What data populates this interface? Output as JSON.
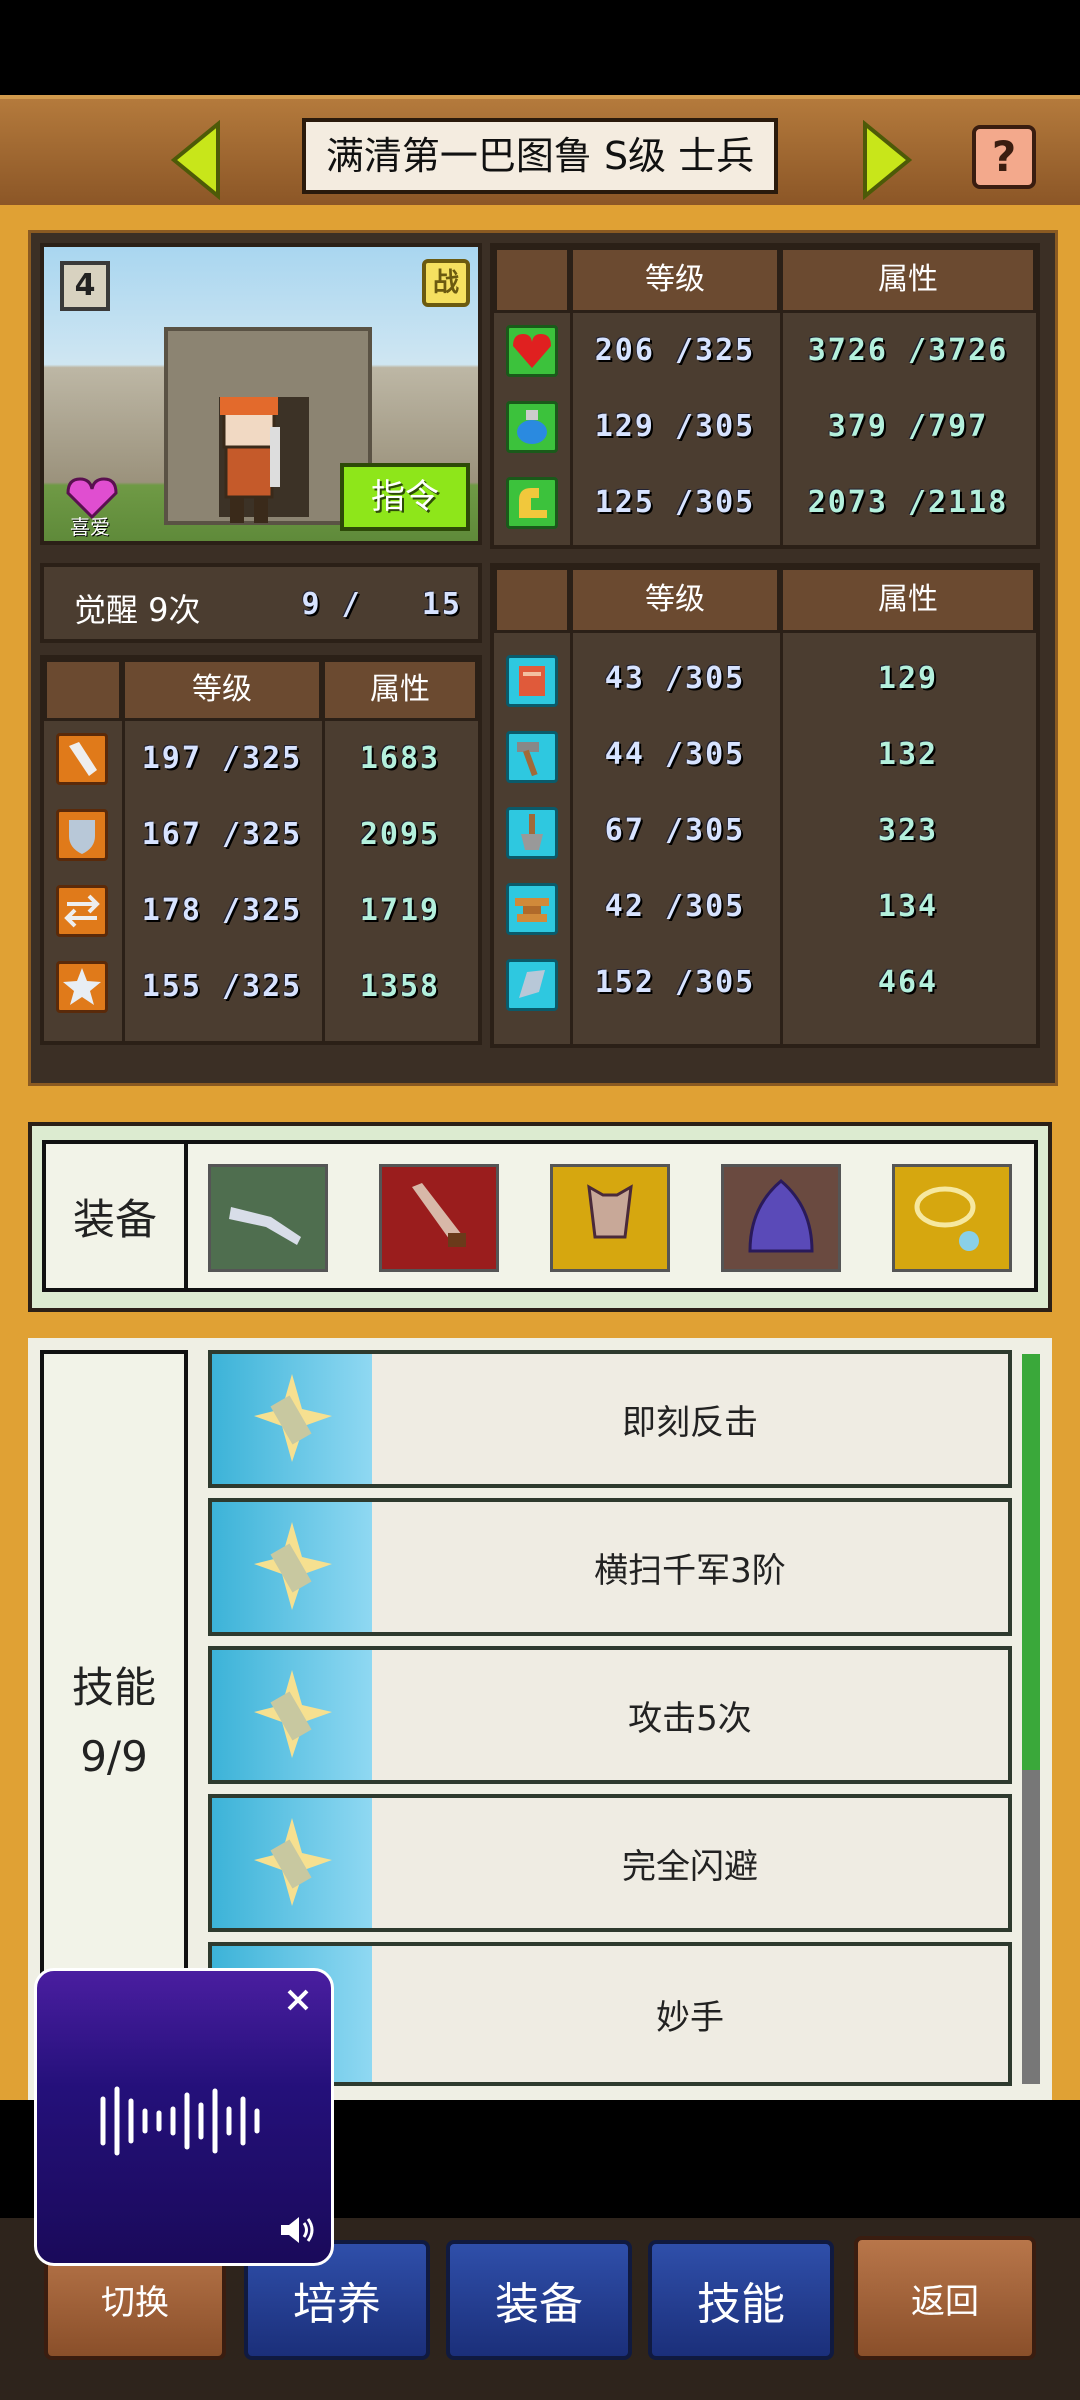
{
  "header": {
    "title": "满清第一巴图鲁 S级 士兵",
    "help": "?"
  },
  "portrait": {
    "level_badge": "4",
    "battle_badge": "战",
    "heart_label": "喜爱",
    "command_button": "指令"
  },
  "top_stats": {
    "headers": [
      "等级",
      "属性"
    ],
    "rows": [
      {
        "icon": "heart-icon",
        "level": "206 /325",
        "attr": "3726 /3726"
      },
      {
        "icon": "potion-icon",
        "level": "129 /305",
        "attr": "379 /797"
      },
      {
        "icon": "strength-icon",
        "level": "125 /305",
        "attr": "2073 /2118"
      }
    ]
  },
  "awaken": {
    "label": "觉醒 9次",
    "count": "9 /   15"
  },
  "combat_stats": {
    "headers": [
      "等级",
      "属性"
    ],
    "rows": [
      {
        "icon": "sword-icon",
        "level": "197 /325",
        "attr": "1683"
      },
      {
        "icon": "shield-icon",
        "level": "167 /325",
        "attr": "2095"
      },
      {
        "icon": "speed-icon",
        "level": "178 /325",
        "attr": "1719"
      },
      {
        "icon": "star-icon",
        "level": "155 /325",
        "attr": "1358"
      }
    ]
  },
  "skill_stats": {
    "headers": [
      "等级",
      "属性"
    ],
    "rows": [
      {
        "icon": "book-icon",
        "level": "43 /305",
        "attr": "129"
      },
      {
        "icon": "hammer-icon",
        "level": "44 /305",
        "attr": "132"
      },
      {
        "icon": "shovel-icon",
        "level": "67 /305",
        "attr": "323"
      },
      {
        "icon": "anvil-icon",
        "level": "42 /305",
        "attr": "134"
      },
      {
        "icon": "ore-icon",
        "level": "152 /305",
        "attr": "464"
      }
    ]
  },
  "equipment": {
    "label": "装备",
    "slots": [
      {
        "icon": "gun-icon",
        "bg": "#4f6e4f"
      },
      {
        "icon": "dagger-icon",
        "bg": "#9a1d1d"
      },
      {
        "icon": "armor-icon",
        "bg": "#d6a70f"
      },
      {
        "icon": "cloak-icon",
        "bg": "#6a4a40"
      },
      {
        "icon": "necklace-icon",
        "bg": "#d6a70f"
      }
    ]
  },
  "skills": {
    "label": "技能",
    "count": "9/9",
    "items": [
      "即刻反击",
      "横扫千军3阶",
      "攻击5次",
      "完全闪避",
      "妙手"
    ]
  },
  "bottom_nav": {
    "switch": "切换",
    "train": "培养",
    "equip": "装备",
    "skill": "技能",
    "back": "返回"
  },
  "colors": {
    "bg": "#e0a134",
    "panel": "#4b3d30",
    "accent_green": "#8ee61a"
  }
}
